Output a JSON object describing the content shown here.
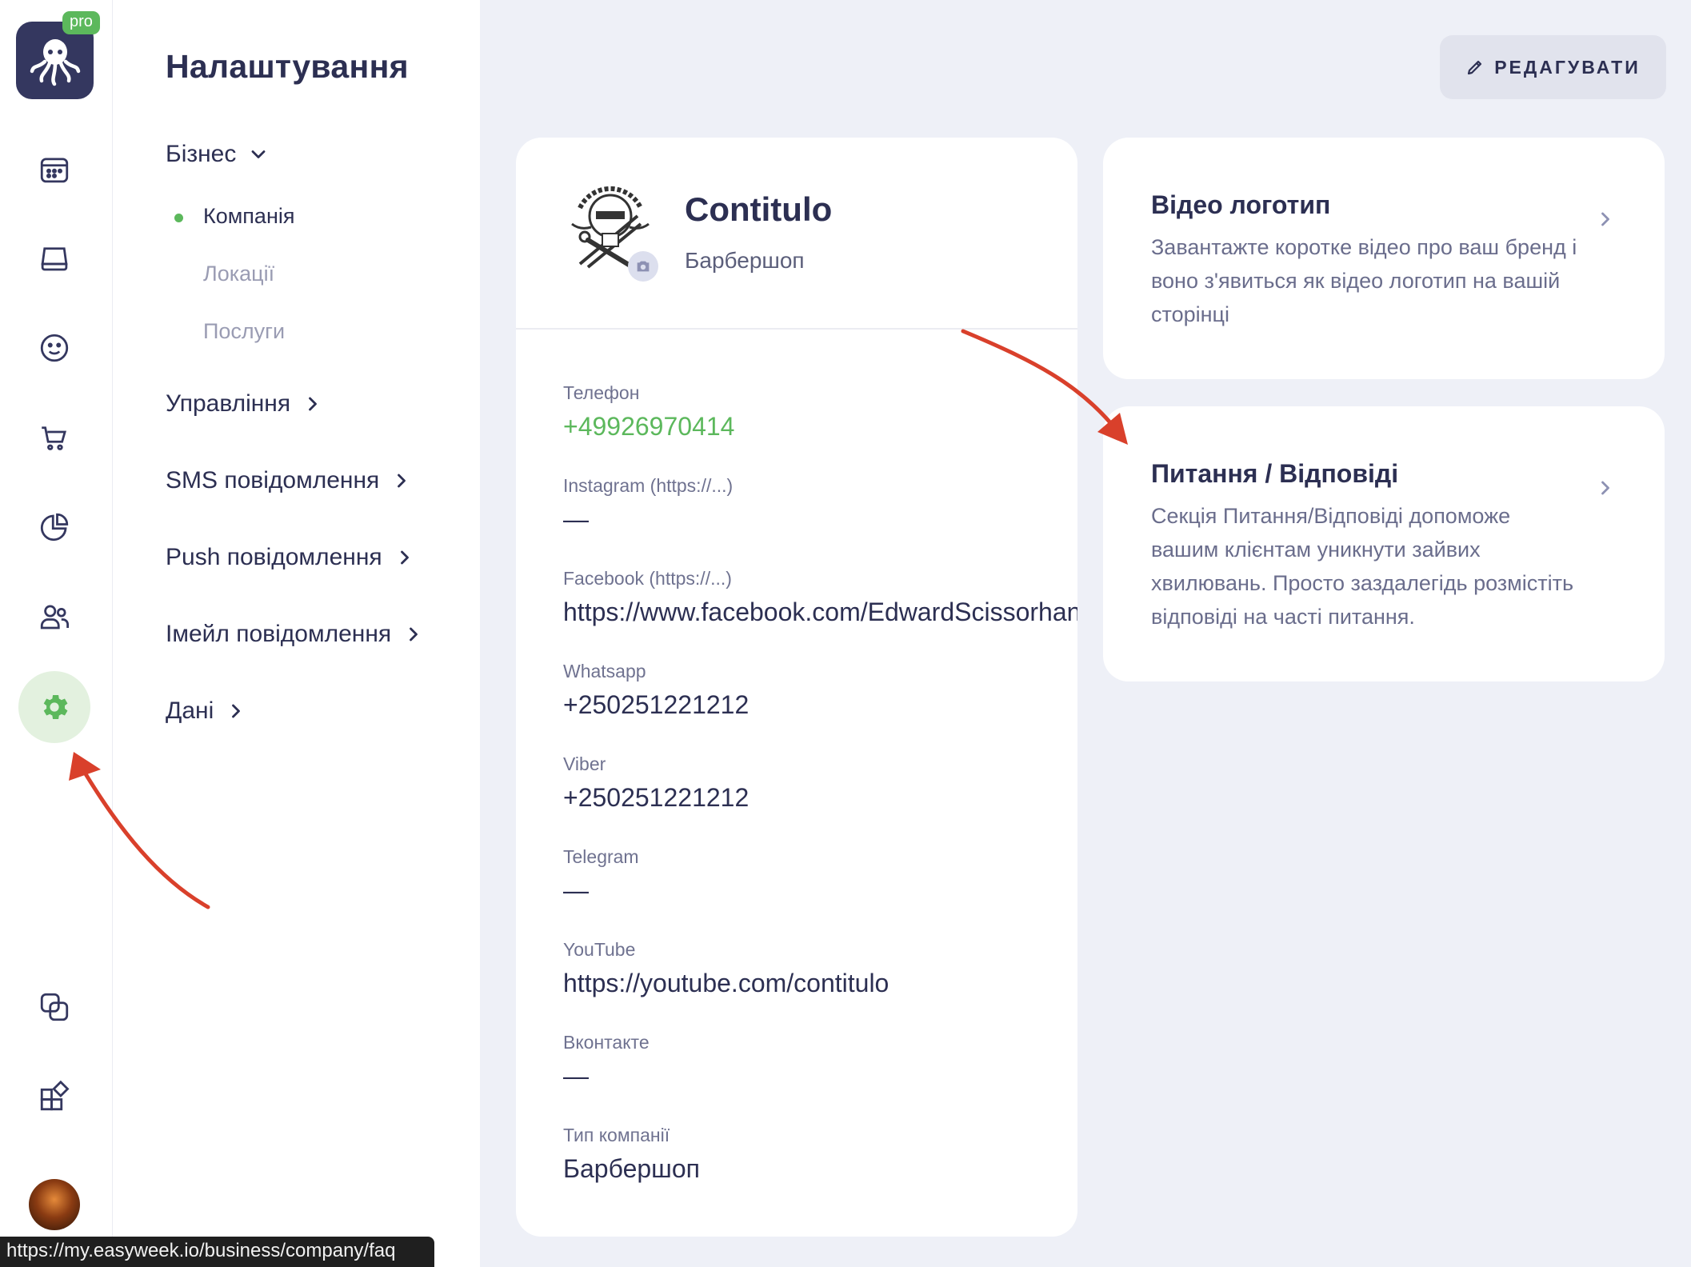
{
  "brand": {
    "badge": "pro",
    "accent": "#5cb85c",
    "dark": "#34375f"
  },
  "rail": {
    "items": [
      {
        "name": "calendar-icon"
      },
      {
        "name": "inbox-icon"
      },
      {
        "name": "smile-icon"
      },
      {
        "name": "cart-icon"
      },
      {
        "name": "pie-chart-icon"
      },
      {
        "name": "users-icon"
      },
      {
        "name": "gear-icon",
        "active": true
      },
      {
        "name": "copy-icon"
      },
      {
        "name": "apps-icon"
      }
    ]
  },
  "settings": {
    "title": "Налаштування",
    "groups": [
      {
        "label": "Бізнес",
        "expanded": true
      },
      {
        "label": "Управління"
      },
      {
        "label": "SMS повідомлення"
      },
      {
        "label": "Push повідомлення"
      },
      {
        "label": "Імейл повідомлення"
      },
      {
        "label": "Дані"
      }
    ],
    "business_items": [
      {
        "label": "Компанія",
        "active": true
      },
      {
        "label": "Локації"
      },
      {
        "label": "Послуги"
      }
    ]
  },
  "toolbar": {
    "edit_label": "РЕДАГУВАТИ"
  },
  "company": {
    "name": "Contitulo",
    "type": "Барбершоп",
    "fields": [
      {
        "label": "Телефон",
        "value": "+49926970414"
      },
      {
        "label": "Instagram (https://...)",
        "value": "—"
      },
      {
        "label": "Facebook (https://...)",
        "value": "https://www.facebook.com/EdwardScissorhand"
      },
      {
        "label": "Whatsapp",
        "value": "+250251221212"
      },
      {
        "label": "Viber",
        "value": "+250251221212"
      },
      {
        "label": "Telegram",
        "value": "—"
      },
      {
        "label": "YouTube",
        "value": "https://youtube.com/contitulo"
      },
      {
        "label": "Вконтакте",
        "value": "—"
      },
      {
        "label": "Тип компанії",
        "value": "Барбершоп"
      }
    ]
  },
  "cards": [
    {
      "title": "Відео логотип",
      "description": "Завантажте коротке відео про ваш бренд і воно з'явиться як відео логотип на вашій сторінці"
    },
    {
      "title": "Питання / Відповіді",
      "description": "Секція Питання/Відповіді допоможе вашим клієнтам уникнути зайвих хвилювань. Просто заздалегідь розмістіть відповіді на часті питання."
    }
  ],
  "status_bar": {
    "url": "https://my.easyweek.io/business/company/faq"
  },
  "annotations": {
    "arrow_color": "#d9402b"
  }
}
